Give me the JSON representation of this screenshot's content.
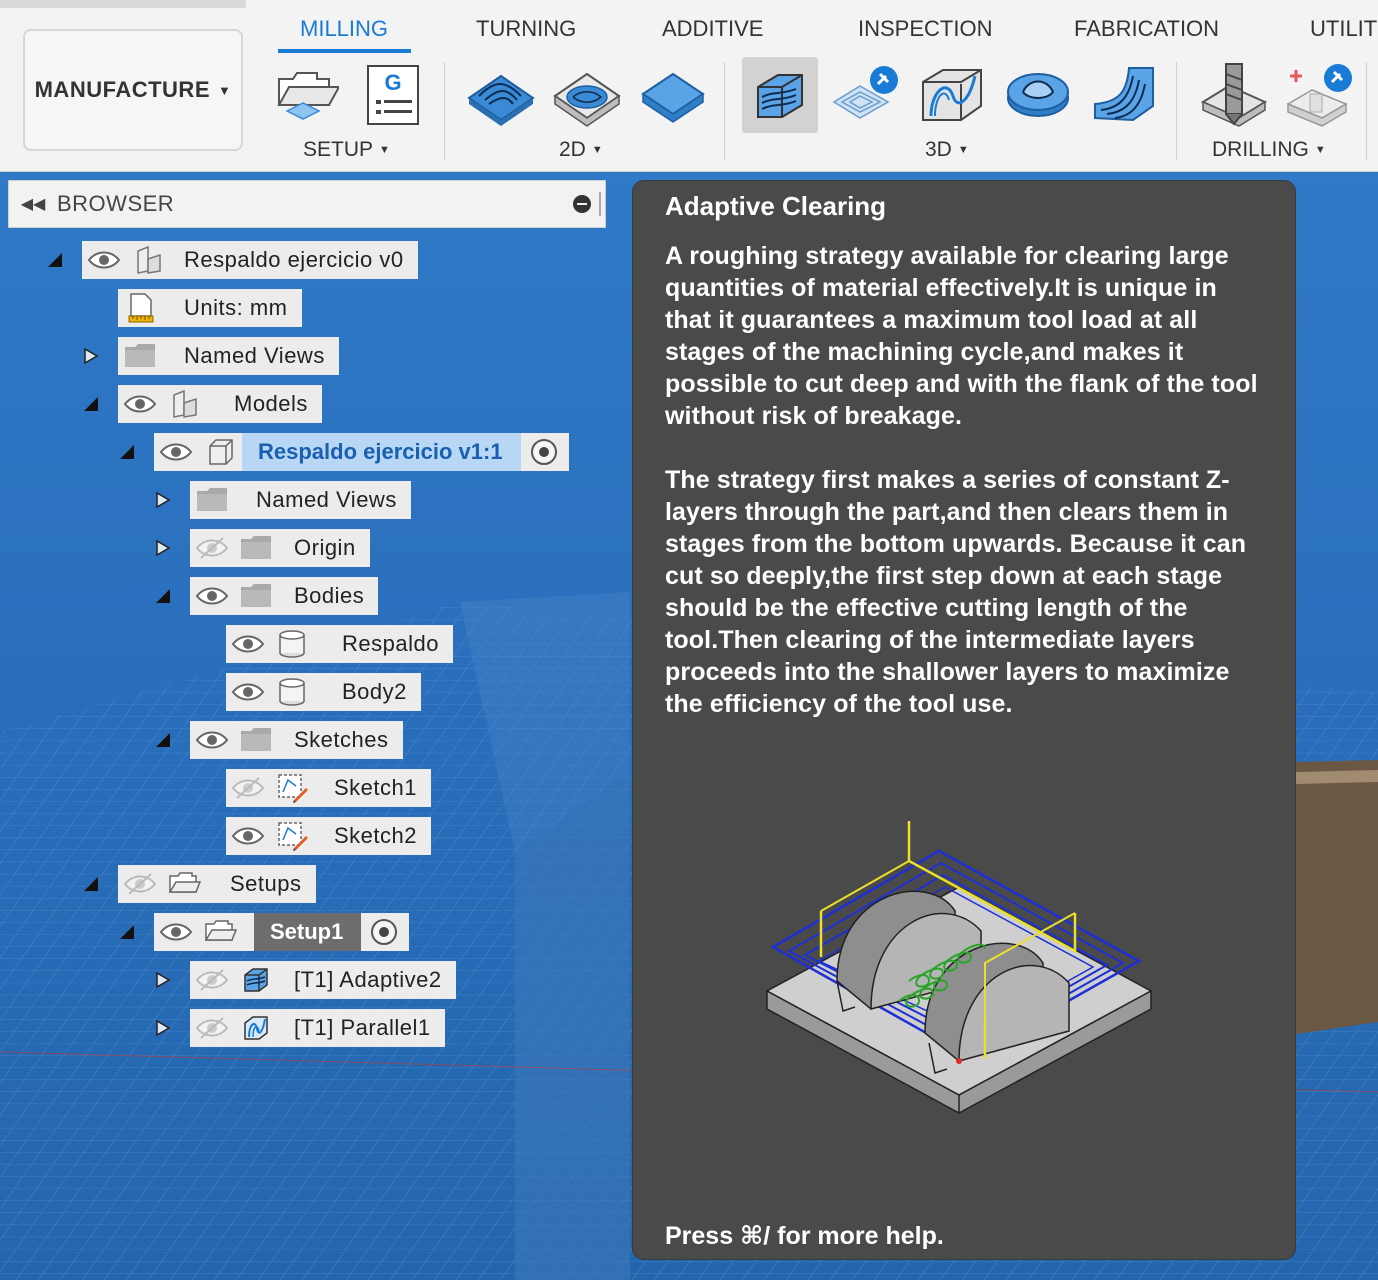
{
  "toolbar": {
    "workspace": "MANUFACTURE",
    "tabs": [
      "MILLING",
      "TURNING",
      "ADDITIVE",
      "INSPECTION",
      "FABRICATION",
      "UTILIT"
    ],
    "active_tab": "MILLING",
    "groups": {
      "setup": "SETUP",
      "two_d": "2D",
      "three_d": "3D",
      "drilling": "DRILLING"
    },
    "g_label": "G"
  },
  "browser": {
    "title": "BROWSER",
    "items": {
      "root": "Respaldo ejercicio v0",
      "units": "Units: mm",
      "named_views": "Named Views",
      "models": "Models",
      "component": "Respaldo ejercicio v1:1",
      "comp_named_views": "Named Views",
      "origin": "Origin",
      "bodies": "Bodies",
      "body_respaldo": "Respaldo",
      "body2": "Body2",
      "sketches": "Sketches",
      "sketch1": "Sketch1",
      "sketch2": "Sketch2",
      "setups": "Setups",
      "setup1": "Setup1",
      "op1": "[T1] Adaptive2",
      "op2": "[T1] Parallel1"
    }
  },
  "tooltip": {
    "title": "Adaptive Clearing",
    "paragraph1": "A roughing strategy available for clearing large quantities of material effectively.It is unique in that it guarantees a maximum tool load at all stages of the machining cycle,and makes it possible to cut deep and with the flank of the tool without risk of breakage.",
    "paragraph2": "The strategy first makes a series of constant Z-layers through the part,and then clears them in stages from the bottom upwards. Because it can cut so deeply,the first step down at each stage should be the effective cutting length of the tool.Then clearing of the intermediate layers proceeds into the shallower layers to maximize the efficiency of the tool use.",
    "footer": "Press ⌘/ for more help."
  },
  "colors": {
    "accent": "#1a7bd6",
    "viewport": "#2a6fbc",
    "tooltip_bg": "#4a4a4a",
    "selection": "#b7d7f5"
  },
  "icons": [
    "eye-icon",
    "eye-hidden-icon",
    "folder-icon",
    "component-icon",
    "body-icon",
    "sketch-icon",
    "setup-icon",
    "operation-icon",
    "units-icon"
  ]
}
